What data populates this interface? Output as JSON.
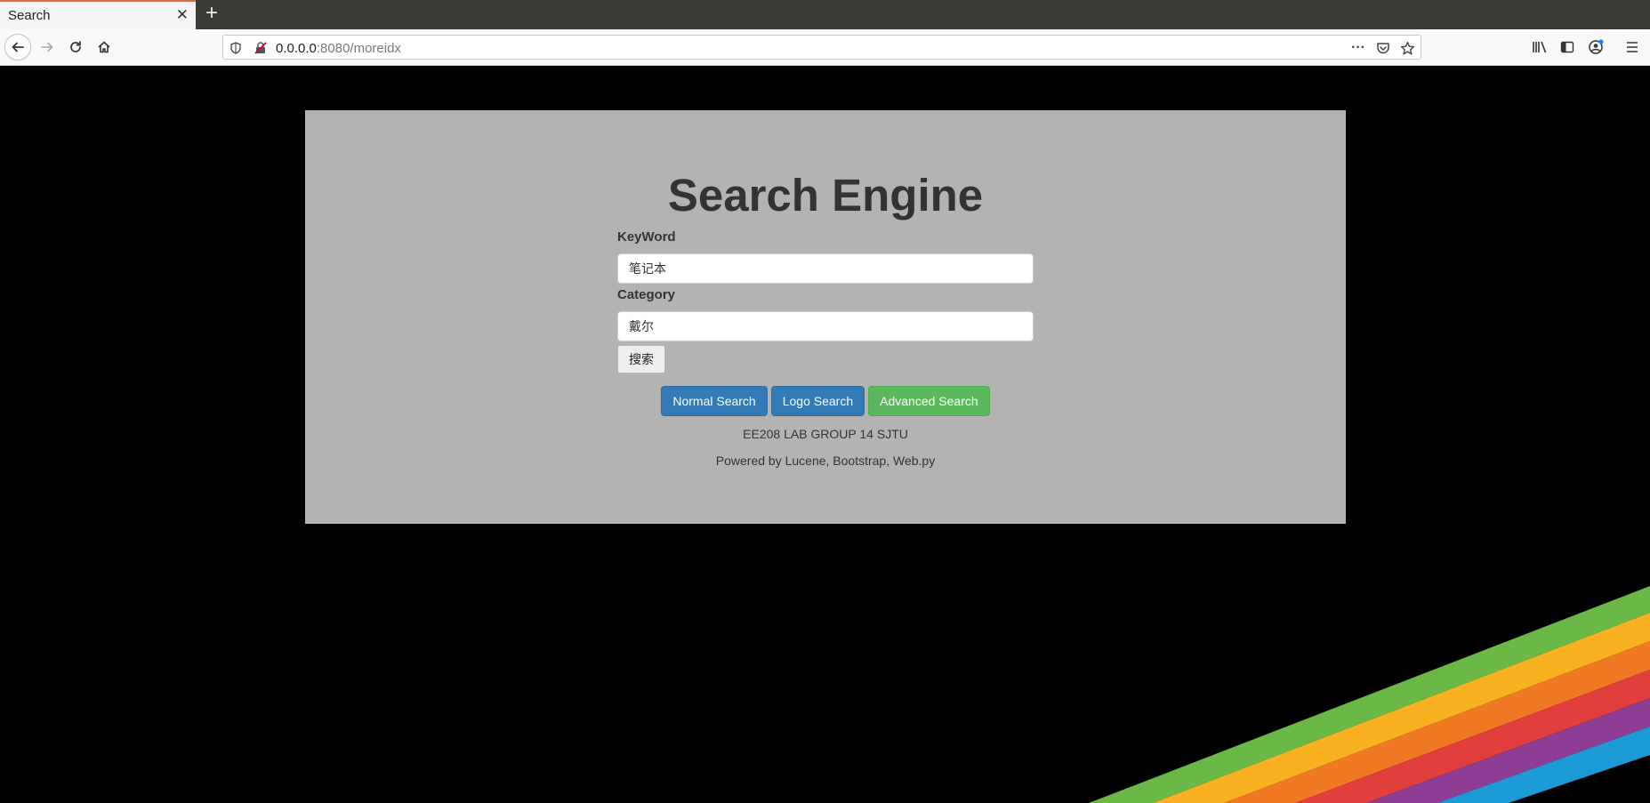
{
  "browser": {
    "tab_title": "Search",
    "url_host": "0.0.0.0",
    "url_rest": ":8080/moreidx"
  },
  "page": {
    "title": "Search Engine",
    "keyword_label": "KeyWord",
    "keyword_value": "笔记本",
    "category_label": "Category",
    "category_value": "戴尔",
    "submit_label": "搜索",
    "buttons": {
      "normal": "Normal Search",
      "logo": "Logo Search",
      "advanced": "Advanced Search"
    },
    "footer_group": "EE208 LAB GROUP 14 SJTU",
    "footer_powered": "Powered by Lucene, Bootstrap, Web.py"
  },
  "colors": {
    "primary": "#337ab7",
    "success": "#5cb85c",
    "panel": "#b3b3b3",
    "rainbow": [
      "#6ab845",
      "#f9b121",
      "#f07a24",
      "#e03f3d",
      "#8d3e94",
      "#1c9ad6"
    ]
  },
  "icons": {
    "back": "back-arrow-icon",
    "forward": "forward-arrow-icon",
    "reload": "reload-icon",
    "home": "home-icon",
    "site_info": "shield-icon",
    "insecure": "insecure-lock-icon",
    "page_actions": "ellipsis-icon",
    "pocket": "pocket-icon",
    "bookmark": "star-icon",
    "library": "library-icon",
    "sidebar": "sidebar-icon",
    "account": "account-icon",
    "menu": "hamburger-menu-icon"
  }
}
